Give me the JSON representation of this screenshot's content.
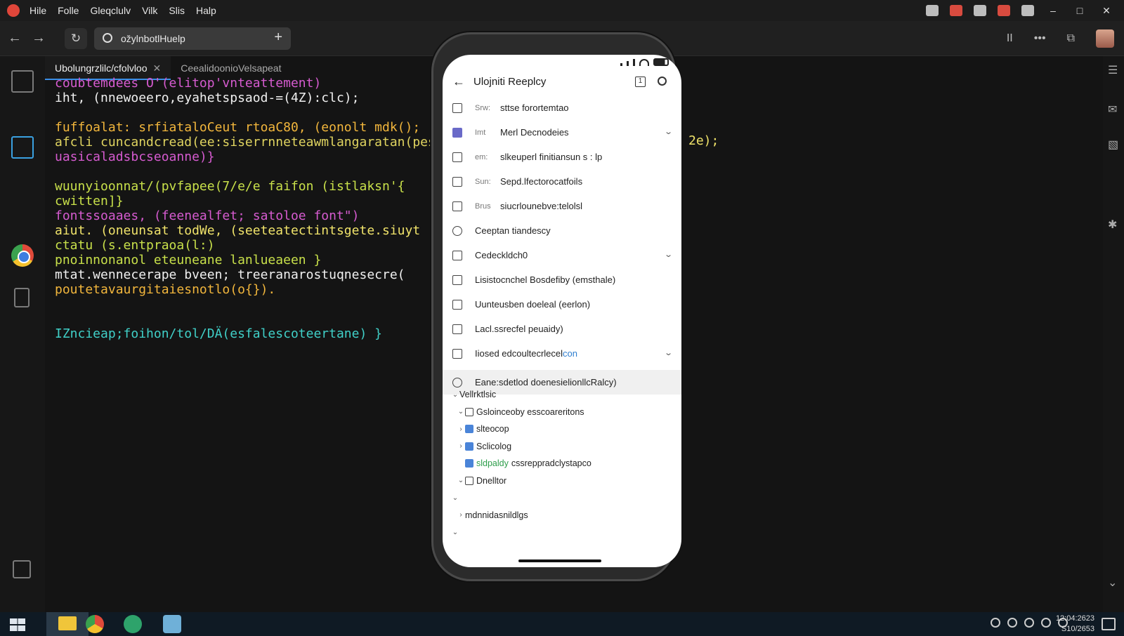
{
  "menubar": {
    "items": [
      "Hile",
      "Folle",
      "Gleqclulv",
      "Vilk",
      "Slis",
      "Halp"
    ]
  },
  "navbar": {
    "url": "ožylnbotlHuelp",
    "new_tab_symbol": "+",
    "back_symbol": "←",
    "forward_symbol": "→",
    "reload_symbol": "↻"
  },
  "tabs": [
    {
      "label": "Ubolungrzlilc/cfolvloo",
      "active": true
    },
    {
      "label": "CeealidoonioVelsapeat",
      "active": false
    }
  ],
  "code": {
    "lines": [
      {
        "text": "coubtemdees O'(elitop'vnteattement)",
        "color": "#d65bd0"
      },
      {
        "text": "iht, (nnewoeero,eyahetspsaod-=(4Z):clc);",
        "color": "#f0f0f0"
      },
      {
        "text": "",
        "color": "#f0f0f0"
      },
      {
        "text": "fuffoalat: srfiataloCeut rtoaC80, (eonolt mdk();",
        "color": "#f2b63c"
      },
      {
        "text": "afcli cuncandcread(ee:siserrnneteawmlangaratan(pes",
        "color": "#e0d460"
      },
      {
        "text": "uasicaladsbcseoanne)}",
        "color": "#d65bd0"
      },
      {
        "text": "",
        "color": "#f0f0f0"
      },
      {
        "text": "wuunyioonnat/(pvfapee(7/e/e faifon (istlaksn'{",
        "color": "#c8e04a"
      },
      {
        "text": "cwitten]}",
        "color": "#c8e04a"
      },
      {
        "text": "fontssoaaes, (feenealfet; satoloe font\")",
        "color": "#d65bd0"
      },
      {
        "text": "aiut. (oneunsat todWe, (seeteatectintsgete.siuyt",
        "color": "#f0e36a"
      },
      {
        "text": "ctatu (s.entpraoa(l:)",
        "color": "#c8e04a"
      },
      {
        "text": "pnoinnonanol eteuneane lanlueaeen }",
        "color": "#c8e04a"
      },
      {
        "text": "mtat.wennecerape bveen; treeranarostuqnesecre(",
        "color": "#f0f0f0"
      },
      {
        "text": "poutetavaurgitaiesnotlo(o{}).",
        "color": "#f2b63c"
      },
      {
        "text": "",
        "color": "#f0f0f0"
      },
      {
        "text": "",
        "color": "#f0f0f0"
      },
      {
        "text": "IZncieap;foihon/tol/DÄ(esfalescoteertane) }",
        "color": "#40d0c8"
      }
    ],
    "overflow_text": "2e);"
  },
  "phone": {
    "app_title": "Ulojniti  Reeplcy",
    "header_box_label": "1",
    "back_symbol": "←",
    "menu": [
      {
        "prefix": "Srw:",
        "label": "sttse forortemtao",
        "icon": "list-icon",
        "chevron": false
      },
      {
        "prefix": "Imt",
        "label": "Merl Decnodeies",
        "icon": "folder-icon",
        "chevron": true
      },
      {
        "prefix": "em:",
        "label": "slkeuperl finitiansun s : lp",
        "icon": "home-icon",
        "chevron": false
      },
      {
        "prefix": "Sun:",
        "label": "Sepd.lfectorocatfoils",
        "icon": "home-icon",
        "chevron": false
      },
      {
        "prefix": "Brus",
        "label": "siucrlounebve:telolsl",
        "icon": "external-link-icon",
        "chevron": false
      },
      {
        "prefix": "",
        "label": "Ceeptan tiandescy",
        "icon": "search-icon",
        "chevron": false
      },
      {
        "prefix": "",
        "label": "Cedeckldch0",
        "icon": "window-icon",
        "chevron": true
      },
      {
        "prefix": "",
        "label": "Lisistocnchel Bosdefiby (emsthale)",
        "icon": "card-icon",
        "chevron": false
      },
      {
        "prefix": "",
        "label": "Uunteusben doeleal (eerlon)",
        "icon": "link-icon",
        "chevron": false
      },
      {
        "prefix": "",
        "label": "Lacl.ssrecfel peuaidy)",
        "icon": "table-icon",
        "chevron": false
      },
      {
        "prefix": "",
        "label": "Iiosed edcoultecrlecel",
        "accent": "con",
        "icon": "box-icon",
        "chevron": true
      },
      {
        "prefix": "",
        "label": "Eane:sdetlod doenesielionllcRalcy)",
        "icon": "clock-icon",
        "chevron": false,
        "highlight": true
      }
    ],
    "tree": [
      {
        "indent": 0,
        "caret": "⌄",
        "icon": "",
        "label": "Vellrktlsic"
      },
      {
        "indent": 1,
        "caret": "⌄",
        "icon": "gray",
        "label": "Gsloinceoby esscoareritons"
      },
      {
        "indent": 1,
        "caret": "›",
        "icon": "blue",
        "label": "slteocop"
      },
      {
        "indent": 1,
        "caret": "›",
        "icon": "blue",
        "label": "Sclicolog"
      },
      {
        "indent": 1,
        "caret": "",
        "icon": "blue",
        "green": "sldpaldy",
        "label": "cssreppradclystapco"
      },
      {
        "indent": 1,
        "caret": "⌄",
        "icon": "edit",
        "label": "Dnelltor"
      },
      {
        "indent": 0,
        "caret": "⌄",
        "icon": "",
        "label": ""
      },
      {
        "indent": 1,
        "caret": "›",
        "icon": "",
        "label": "mdnnidasnildlgs"
      },
      {
        "indent": 0,
        "caret": "⌄",
        "icon": "",
        "label": ""
      }
    ]
  },
  "taskbar": {
    "clock_time": "12:04:2623",
    "clock_date": "S10/2653"
  },
  "colors": {
    "accent": "#3a8ee6",
    "background": "#141414",
    "phone_screen": "#ffffff"
  }
}
